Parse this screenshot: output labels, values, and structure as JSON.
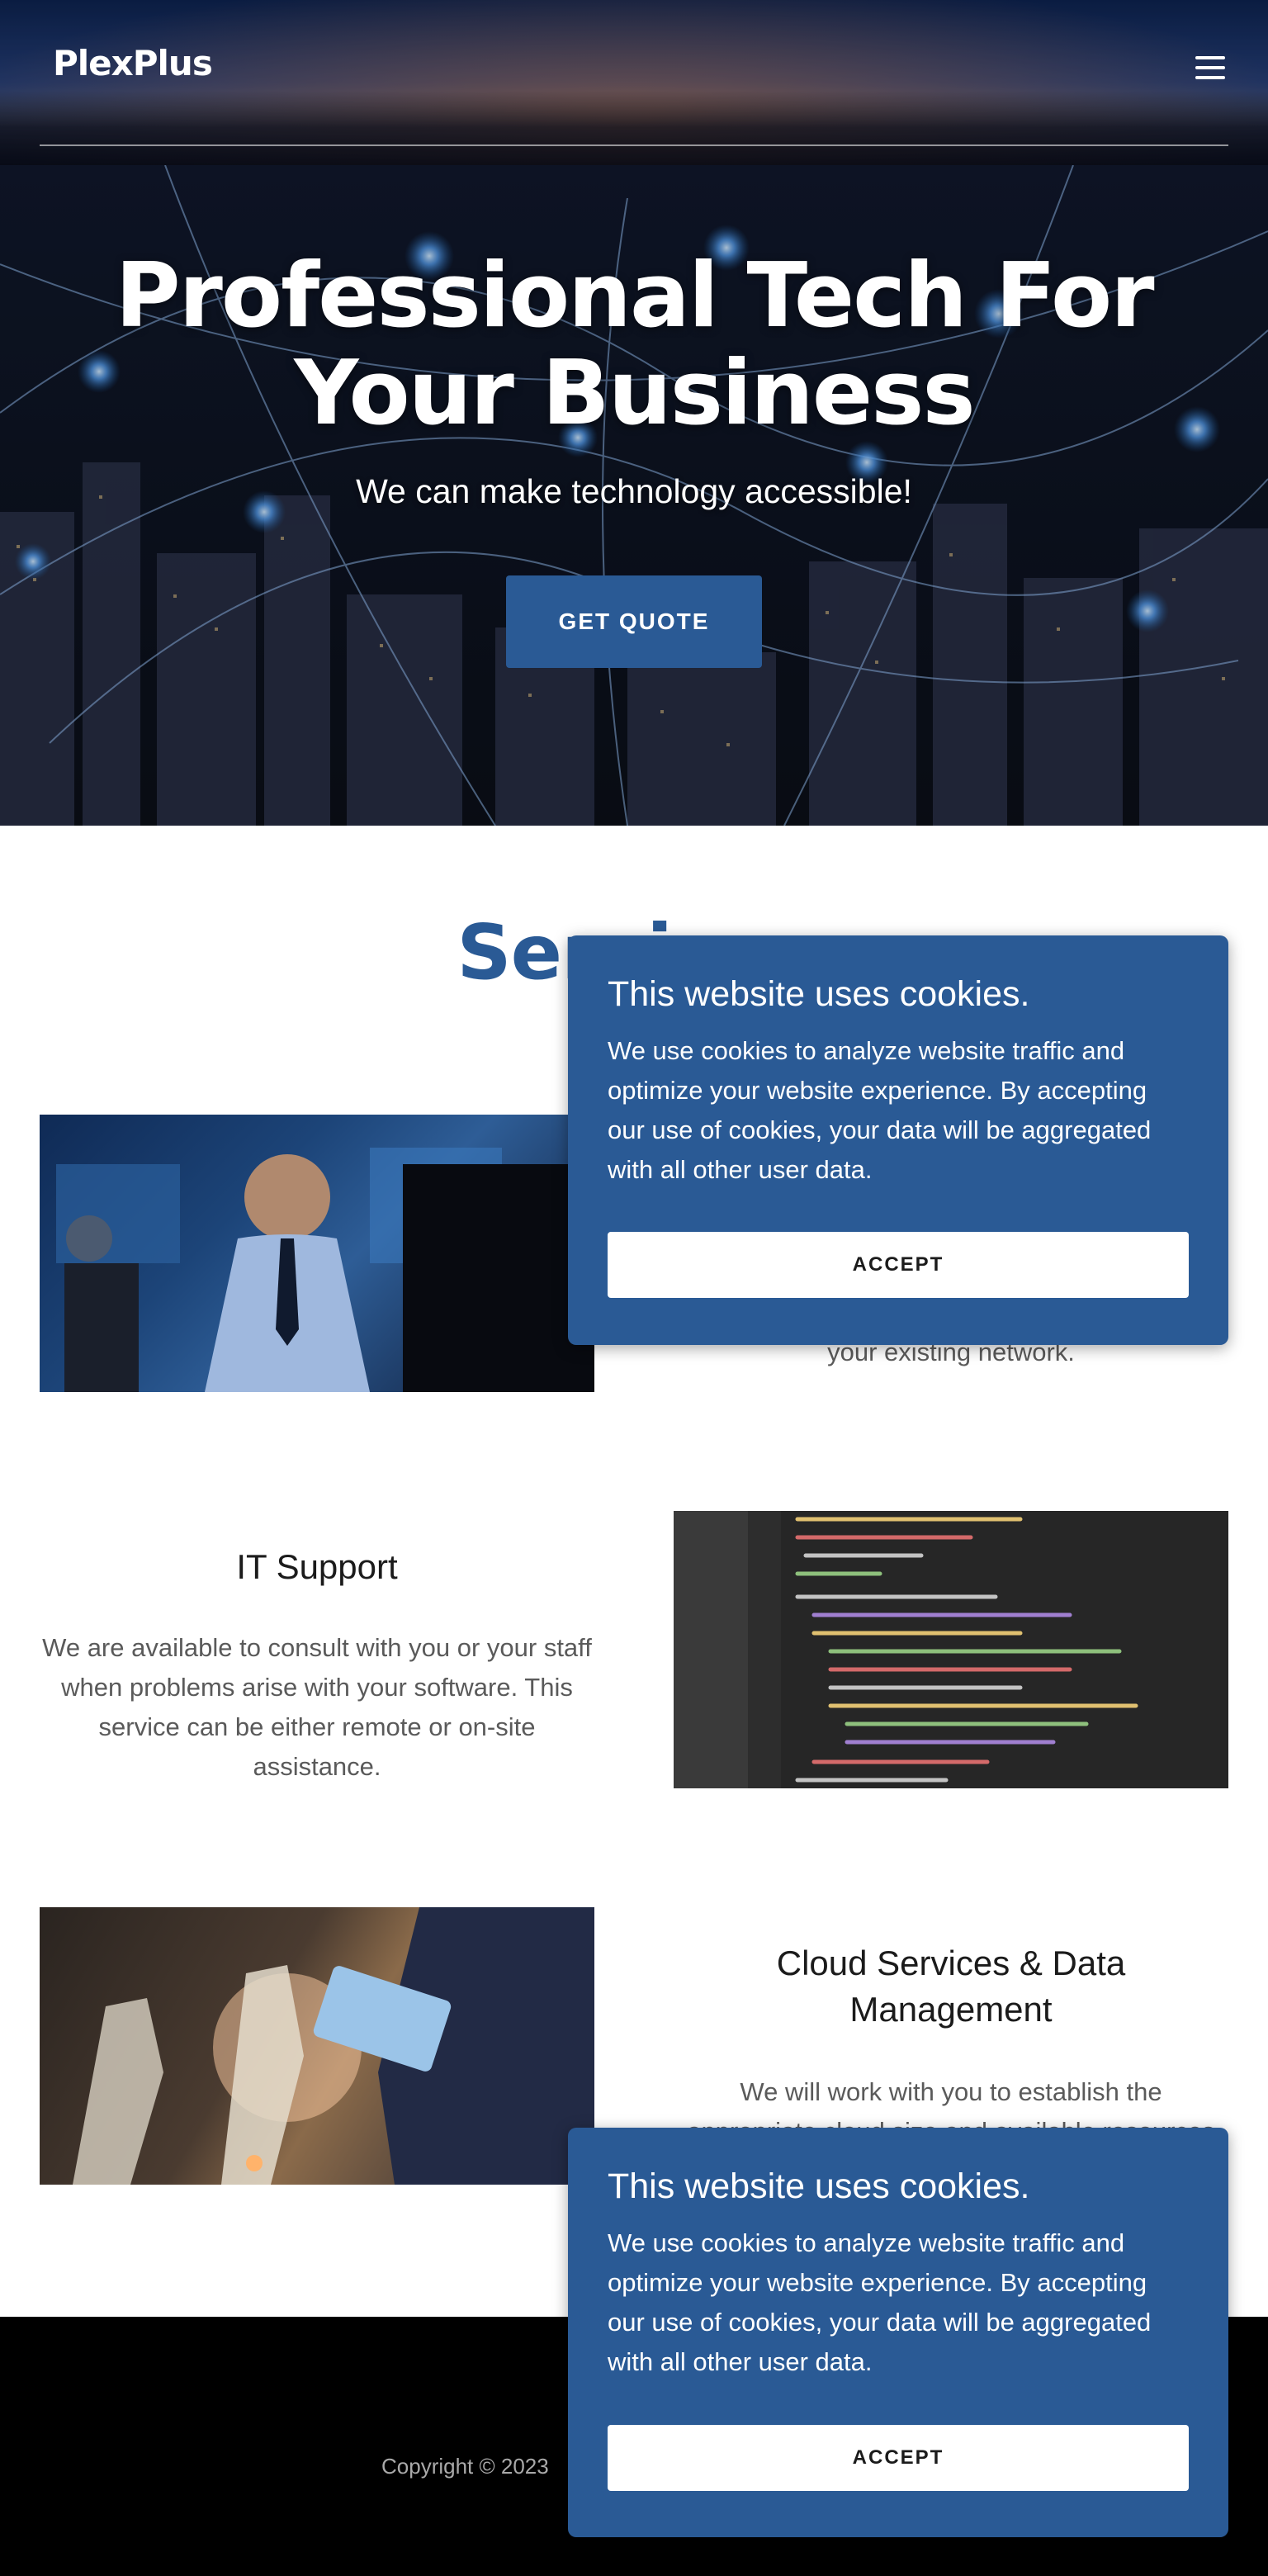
{
  "header": {
    "logo": "PlexPlus",
    "menu_icon": "hamburger-menu-icon"
  },
  "hero": {
    "title": "Professional Tech For Your Business",
    "subtitle": "We can make technology accessible!",
    "cta_label": "GET QUOTE"
  },
  "services": {
    "title": "Services",
    "items": [
      {
        "title": "",
        "description_visible_tail": "your existing network.",
        "image": "businessman-at-computer-photo"
      },
      {
        "title": "IT Support",
        "description": "We are available to consult with you or your staff when problems arise with your software. This service can be either remote or on-site assistance.",
        "image": "code-editor-screenshot-photo"
      },
      {
        "title": "Cloud Services & Data Management",
        "description": "We will work with you to establish the appropriate cloud size and available resources",
        "image": "industrial-robots-tablet-photo"
      }
    ]
  },
  "footer": {
    "copyright": "Copyright © 2023"
  },
  "cookie_banner": {
    "title": "This website uses cookies.",
    "body": "We use cookies to analyze website traffic and optimize your website experience. By accepting our use of cookies, your data will be aggregated with all other user data.",
    "accept_label": "ACCEPT"
  },
  "colors": {
    "brand_blue": "#2a5a95",
    "footer_bg": "#000000",
    "text_dark": "#1b1b1b",
    "text_muted": "#5a5a5a"
  }
}
